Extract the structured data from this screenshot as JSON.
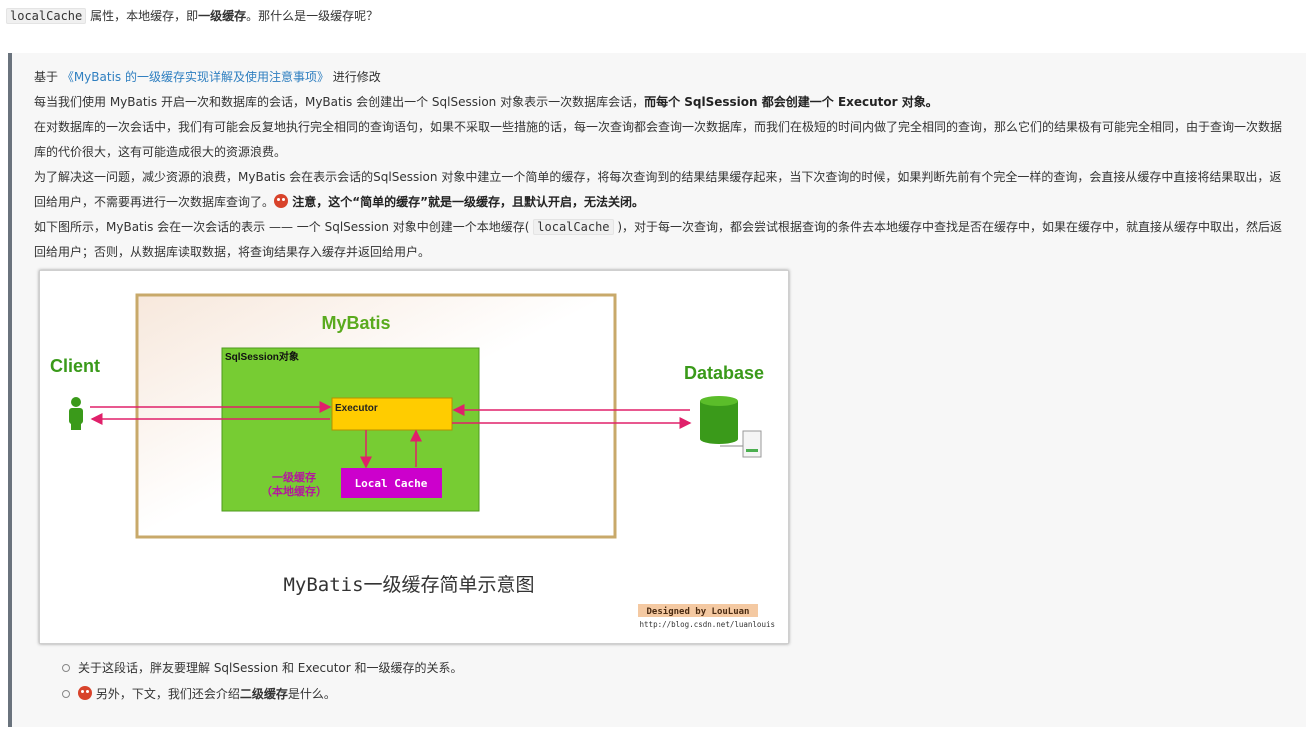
{
  "top": {
    "code": "localCache",
    "text1": " 属性，本地缓存，即",
    "bold": "一级缓存",
    "text2": "。那什么是一级缓存呢？"
  },
  "quote": {
    "line1": {
      "prefix": "基于 ",
      "link": "《MyBatis 的一级缓存实现详解及使用注意事项》",
      "suffix": " 进行修改"
    },
    "line2": {
      "text": "每当我们使用 MyBatis 开启一次和数据库的会话，MyBatis 会创建出一个 SqlSession 对象表示一次数据库会话，",
      "bold": "而每个 SqlSession 都会创建一个 Executor 对象。"
    },
    "line3": {
      "text": "在对数据库的一次会话中，我们有可能会反复地执行完全相同的查询语句，如果不采取一些措施的话，每一次查询都会查询一次数据库，而我们在极短的时间内做了完全相同的查询，那么它们的结果极有可能完全相同，由于查询一次数据库的代价很大，这有可能造成很大的资源浪费。"
    },
    "line4": {
      "text": "为了解决这一问题，减少资源的浪费，MyBatis 会在表示会话的SqlSession 对象中建立一个简单的缓存，将每次查询到的结果结果缓存起来，当下次查询的时候，如果判断先前有个完全一样的查询，会直接从缓存中直接将结果取出，返回给用户，不需要再进行一次数据库查询了。",
      "bold": " 注意，这个“简单的缓存”就是一级缓存，且默认开启，无法关闭。"
    },
    "line5": {
      "text1": "如下图所示，MyBatis 会在一次会话的表示 —— 一个 SqlSession 对象中创建一个本地缓存( ",
      "code": "localCache",
      "text2": " )，对于每一次查询，都会尝试根据查询的条件去本地缓存中查找是否在缓存中，如果在缓存中，就直接从缓存中取出，然后返回给用户；否则，从数据库读取数据，将查询结果存入缓存并返回给用户。"
    }
  },
  "diagram": {
    "title": "MyBatis",
    "sqlsession": "SqlSession对象",
    "client": "Client",
    "database": "Database",
    "executor": "Executor",
    "local_cache": "Local Cache",
    "cache_label1": "一级缓存",
    "cache_label2": "（本地缓存）",
    "caption": "MyBatis一级缓存简单示意图",
    "designed": "Designed by LouLuan",
    "url": "http://blog.csdn.net/luanlouis",
    "colors": {
      "green": "#77cc33",
      "executor": "#ffcc00",
      "cache": "#cc00cc",
      "arrow": "#e0206a",
      "title": "#5aaa1e",
      "client": "#3a9a1a"
    }
  },
  "bullets": {
    "item1": "关于这段话，胖友要理解 SqlSession 和 Executor 和一级缓存的关系。",
    "item2": {
      "text1": " 另外，下文，我们还会介绍",
      "bold": "二级缓存",
      "text2": "是什么。"
    }
  }
}
